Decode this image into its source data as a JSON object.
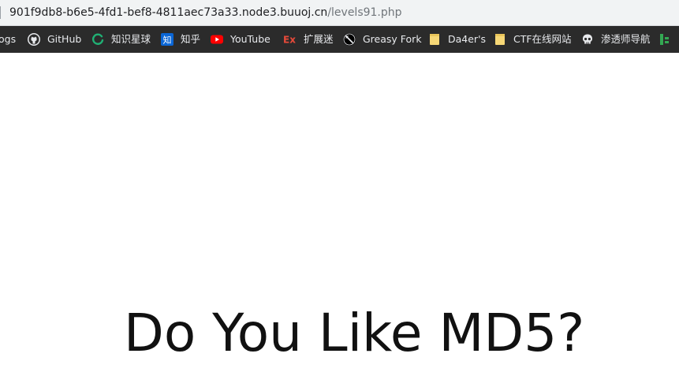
{
  "address_bar": {
    "url_host": "901f9db8-b6e5-4fd1-bef8-4811aec73a33.node3.buuoj.cn",
    "url_path": "/levels91.php"
  },
  "bookmarks": [
    {
      "label": "ogs",
      "icon": "none"
    },
    {
      "label": "GitHub",
      "icon": "github-icon"
    },
    {
      "label": "知识星球",
      "icon": "zsxq-icon"
    },
    {
      "label": "知乎",
      "icon": "zhihu-icon"
    },
    {
      "label": "YouTube",
      "icon": "youtube-icon"
    },
    {
      "label": "扩展迷",
      "icon": "ex-icon"
    },
    {
      "label": "Greasy Fork",
      "icon": "greasyfork-icon"
    },
    {
      "label": "Da4er's",
      "icon": "folder-icon"
    },
    {
      "label": "CTF在线网站",
      "icon": "folder-icon"
    },
    {
      "label": "渗透师导航",
      "icon": "skull-icon"
    },
    {
      "label": "",
      "icon": "green-bookmark-icon"
    }
  ],
  "page": {
    "headline": "Do You Like MD5?"
  },
  "colors": {
    "bookmarks_bar_bg": "#2b2b2b",
    "address_bar_bg": "#f1f3f4",
    "youtube_red": "#ff0000",
    "zhihu_blue": "#0a66d6",
    "zsxq_green": "#20b074",
    "folder_yellow": "#f6d776"
  }
}
